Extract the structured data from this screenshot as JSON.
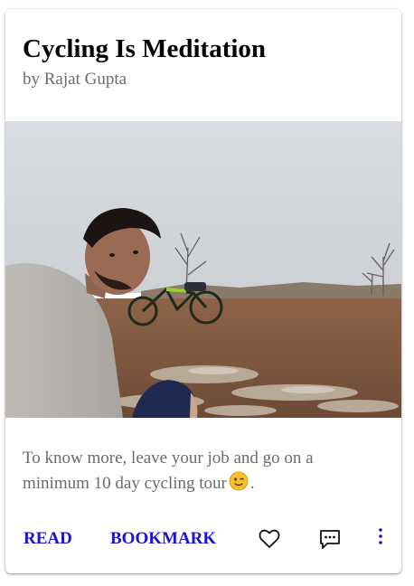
{
  "post": {
    "title": "Cycling Is Meditation",
    "byline": "by Rajat Gupta",
    "description_before_emoji": "To know more, leave your job and go on a minimum 10 day cycling tour",
    "description_after_emoji": "."
  },
  "actions": {
    "read_label": "READ",
    "bookmark_label": "BOOKMARK"
  },
  "icons": {
    "like": "heart-outline-icon",
    "comment": "comment-icon",
    "more": "more-vertical-icon",
    "emoji": "winking-face-emoji"
  },
  "colors": {
    "accent": "#1a10d8",
    "title": "#000000",
    "muted_text": "#6b6b6b",
    "emoji": "#f7c02c"
  }
}
